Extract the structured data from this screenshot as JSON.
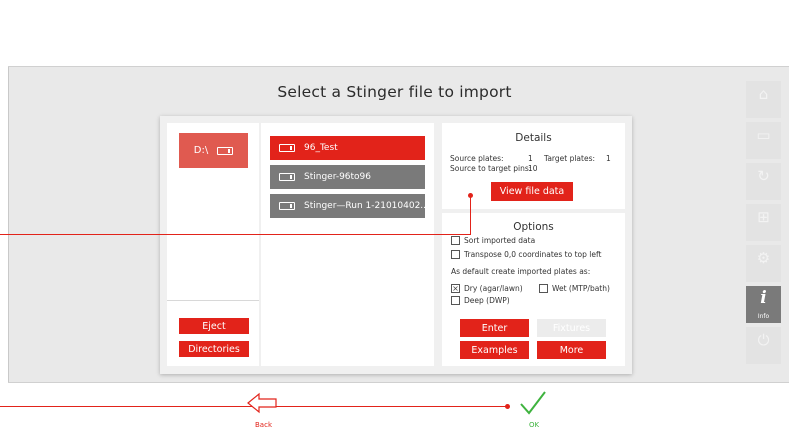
{
  "page": {
    "title": "Select a Stinger file to import"
  },
  "drives": {
    "selected_label": "D:\\"
  },
  "files": [
    {
      "name": "96_Test",
      "selected": true
    },
    {
      "name": "Stinger-96to96",
      "selected": false
    },
    {
      "name": "Stinger—Run 1-21010402...",
      "selected": false
    }
  ],
  "left_buttons": {
    "eject": "Eject",
    "directories": "Directories"
  },
  "details": {
    "title": "Details",
    "source_plates_label": "Source plates:",
    "source_plates_value": "1",
    "target_plates_label": "Target plates:",
    "target_plates_value": "1",
    "pins_label": "Source to target pins:",
    "pins_value": "10",
    "view_button": "View file data"
  },
  "options": {
    "title": "Options",
    "sort_label": "Sort imported data",
    "transpose_label": "Transpose 0,0 coordinates to top left",
    "default_label": "As default create imported plates as:",
    "dry_label": "Dry (agar/lawn)",
    "wet_label": "Wet (MTP/bath)",
    "deep_label": "Deep (DWP)",
    "enter_button": "Enter",
    "fixtures_button": "Fixtures",
    "examples_button": "Examples",
    "more_button": "More"
  },
  "sidebar": {
    "info_label": "Info"
  },
  "bottom_nav": {
    "back_label": "Back",
    "ok_label": "OK"
  },
  "colors": {
    "accent_red": "#e2231a",
    "ok_green": "#3fb33f",
    "unselected_gray": "#7a7a7a"
  }
}
